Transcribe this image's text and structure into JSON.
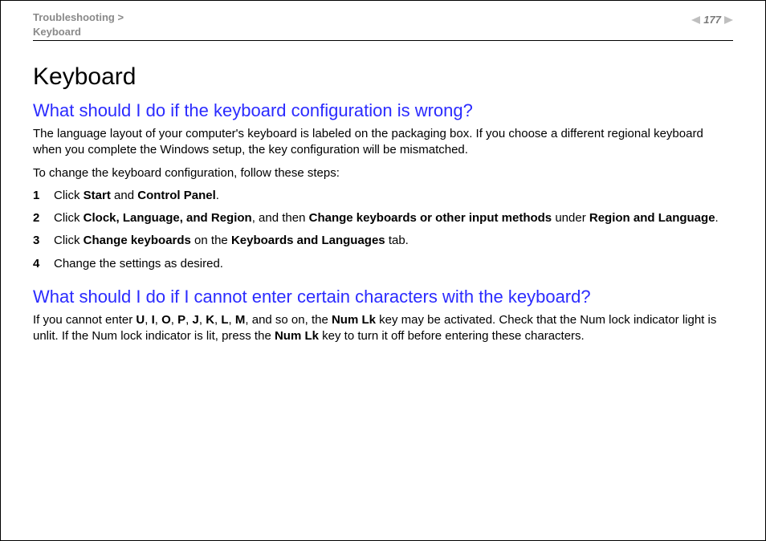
{
  "header": {
    "breadcrumb_parent": "Troubleshooting",
    "breadcrumb_sep": ">",
    "breadcrumb_current": "Keyboard",
    "page_number": "177"
  },
  "title": "Keyboard",
  "section1": {
    "question": "What should I do if the keyboard configuration is wrong?",
    "intro": "The language layout of your computer's keyboard is labeled on the packaging box. If you choose a different regional keyboard when you complete the Windows setup, the key configuration will be mismatched.",
    "lead": "To change the keyboard configuration, follow these steps:",
    "steps": {
      "s1": {
        "t0": "Click ",
        "b0": "Start",
        "t1": " and ",
        "b1": "Control Panel",
        "t2": "."
      },
      "s2": {
        "t0": "Click ",
        "b0": "Clock, Language, and Region",
        "t1": ", and then ",
        "b1": "Change keyboards or other input methods",
        "t2": " under ",
        "b2": "Region and Language",
        "t3": "."
      },
      "s3": {
        "t0": "Click ",
        "b0": "Change keyboards",
        "t1": " on the ",
        "b1": "Keyboards and Languages",
        "t2": " tab."
      },
      "s4": {
        "t0": "Change the settings as desired."
      }
    }
  },
  "section2": {
    "question": "What should I do if I cannot enter certain characters with the keyboard?",
    "para": {
      "t0": "If you cannot enter ",
      "b0": "U",
      "c0": ", ",
      "b1": "I",
      "c1": ", ",
      "b2": "O",
      "c2": ", ",
      "b3": "P",
      "c3": ", ",
      "b4": "J",
      "c4": ", ",
      "b5": "K",
      "c5": ", ",
      "b6": "L",
      "c6": ", ",
      "b7": "M",
      "c7": ", and so on, the ",
      "b8": "Num Lk",
      "t1": " key may be activated. Check that the Num lock indicator light is unlit. If the Num lock indicator is lit, press the ",
      "b9": "Num Lk",
      "t2": " key to turn it off before entering these characters."
    }
  }
}
